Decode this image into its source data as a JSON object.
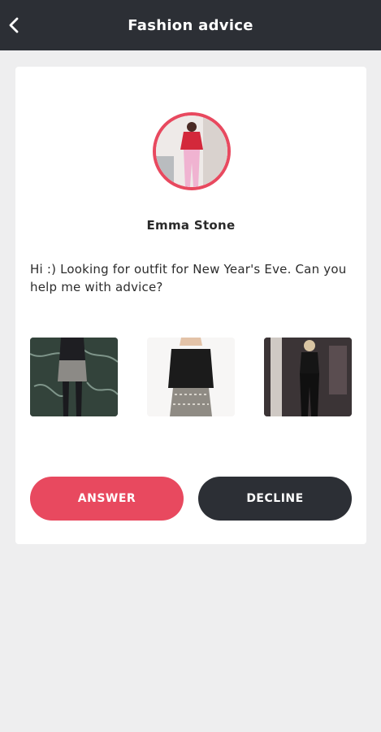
{
  "header": {
    "title": "Fashion advice",
    "back_icon": "chevron-left-icon"
  },
  "request": {
    "user_name": "Emma Stone",
    "message": "Hi :) Looking for outfit for New Year's Eve. Can you help me with advice?",
    "photos": [
      {
        "name": "outfit-photo-1"
      },
      {
        "name": "outfit-photo-2"
      },
      {
        "name": "outfit-photo-3"
      }
    ]
  },
  "actions": {
    "answer_label": "ANSWER",
    "decline_label": "DECLINE"
  },
  "colors": {
    "accent": "#e8495f",
    "dark": "#2c2f35",
    "background": "#eeeeef"
  }
}
